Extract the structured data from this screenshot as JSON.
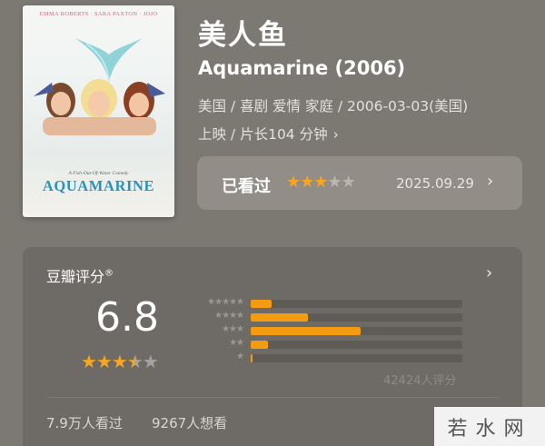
{
  "poster": {
    "credits": "EMMA ROBERTS · SARA PAXTON · JOJO",
    "tagline": "A Fish-Out-Of-Water Comedy",
    "logo": "AQUAMARINE"
  },
  "movie": {
    "title_cn": "美人鱼",
    "title_en": "Aquamarine (2006)",
    "meta_line1": "美国 / 喜剧 爱情 家庭 / 2006-03-03(美国)",
    "meta_line2": "上映 / 片长104 分钟",
    "meta_chevron": "›"
  },
  "watched": {
    "label": "已看过",
    "user_rating_stars": 3,
    "date": "2025.09.29",
    "chevron": "›"
  },
  "rating": {
    "header": "豆瓣评分",
    "header_mark": "®",
    "chevron": "›",
    "score": "6.8",
    "score_stars": 3.5,
    "distribution": [
      {
        "stars": 5,
        "label": "★★★★★",
        "percent": 10
      },
      {
        "stars": 4,
        "label": "★★★★",
        "percent": 27
      },
      {
        "stars": 3,
        "label": "★★★",
        "percent": 52
      },
      {
        "stars": 2,
        "label": "★★",
        "percent": 8
      },
      {
        "stars": 1,
        "label": "★",
        "percent": 1
      }
    ],
    "count": "42424人评分",
    "seen": "7.9万人看过",
    "want": "9267人想看"
  },
  "watermark": "若水网",
  "colors": {
    "accent": "#f6a623",
    "bar_fill": "#f39c12",
    "background": "#7c7872"
  }
}
